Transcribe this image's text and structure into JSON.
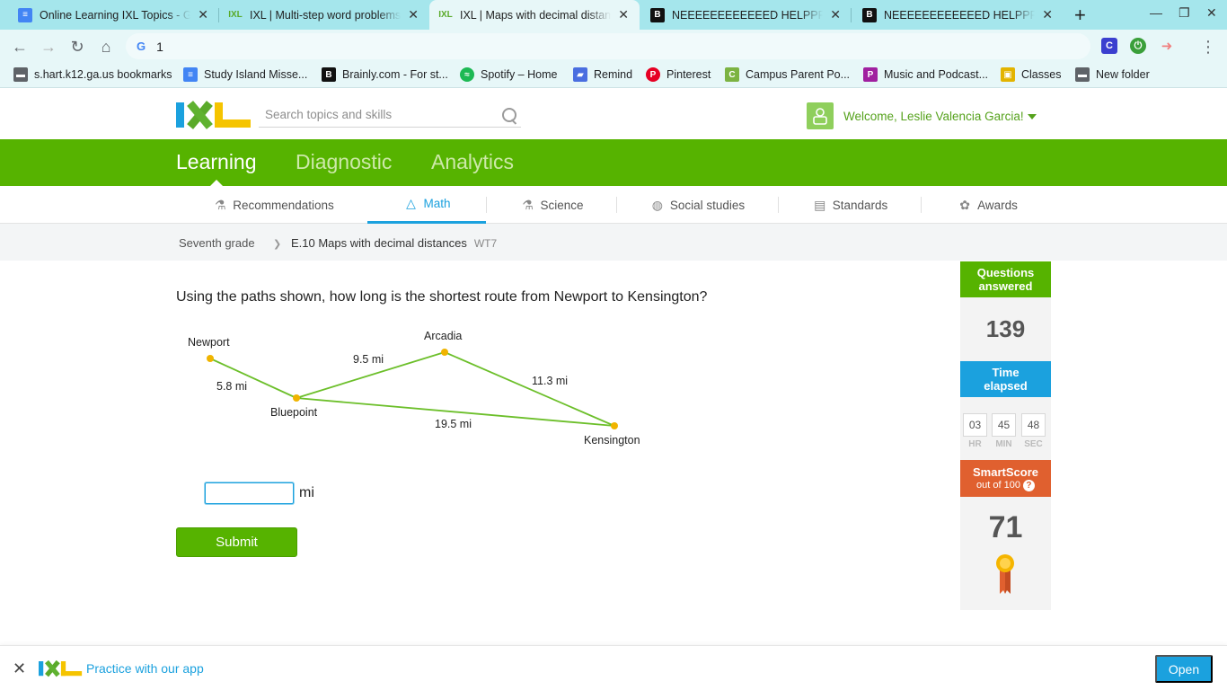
{
  "browser": {
    "tabs": [
      {
        "title": "Online Learning IXL Topics - Goo",
        "favicon": "docs-icon"
      },
      {
        "title": "IXL | Multi-step word problems |",
        "favicon": "ixl-icon"
      },
      {
        "title": "IXL | Maps with decimal distance",
        "favicon": "ixl-icon",
        "active": true
      },
      {
        "title": "NEEEEEEEEEEEED HELPPPPP",
        "favicon": "brainly-icon"
      },
      {
        "title": "NEEEEEEEEEEEED HELPPPPP",
        "favicon": "brainly-icon"
      }
    ],
    "address": "1",
    "bookmarks": [
      {
        "label": "s.hart.k12.ga.us bookmarks",
        "icon": "folder-icon"
      },
      {
        "label": "Study Island Misse...",
        "icon": "docs-icon"
      },
      {
        "label": "Brainly.com - For st...",
        "icon": "brainly-icon"
      },
      {
        "label": "Spotify – Home",
        "icon": "spotify-icon"
      },
      {
        "label": "Remind",
        "icon": "remind-icon"
      },
      {
        "label": "Pinterest",
        "icon": "pinterest-icon"
      },
      {
        "label": "Campus Parent Po...",
        "icon": "campus-icon"
      },
      {
        "label": "Music and Podcast...",
        "icon": "pandora-icon"
      },
      {
        "label": "Classes",
        "icon": "classroom-icon"
      },
      {
        "label": "New folder",
        "icon": "folder-icon"
      }
    ]
  },
  "header": {
    "search_placeholder": "Search topics and skills",
    "welcome": "Welcome, Leslie Valencia Garcia!"
  },
  "nav": {
    "main": [
      "Learning",
      "Diagnostic",
      "Analytics"
    ],
    "subjects": [
      "Recommendations",
      "Math",
      "Science",
      "Social studies",
      "Standards",
      "Awards"
    ]
  },
  "breadcrumb": {
    "grade": "Seventh grade",
    "skill": "E.10 Maps with decimal distances",
    "code": "WT7"
  },
  "question": {
    "prompt": "Using the paths shown, how long is the shortest route from Newport to Kensington?",
    "cities": {
      "newport": "Newport",
      "arcadia": "Arcadia",
      "bluepoint": "Bluepoint",
      "kensington": "Kensington"
    },
    "distances": {
      "newport_bluepoint": "5.8 mi",
      "bluepoint_arcadia": "9.5 mi",
      "arcadia_kensington": "11.3 mi",
      "bluepoint_kensington": "19.5 mi"
    },
    "answer_value": "",
    "unit": "mi",
    "submit_label": "Submit"
  },
  "stats": {
    "questions_label": "Questions answered",
    "questions_value": "139",
    "time_label": "Time elapsed",
    "time": {
      "hr": "03",
      "min": "45",
      "sec": "48"
    },
    "time_units": {
      "hr": "HR",
      "min": "MIN",
      "sec": "SEC"
    },
    "smartscore_label": "SmartScore",
    "smartscore_sub": "out of 100",
    "smartscore_value": "71"
  },
  "banner": {
    "text": "Practice with our app",
    "open_label": "Open"
  },
  "colors": {
    "ixl_green": "#56b300",
    "ixl_blue": "#1ba1de",
    "smartscore_orange": "#e0602f",
    "map_path": "#6cbf2a",
    "map_node": "#f0b400"
  }
}
